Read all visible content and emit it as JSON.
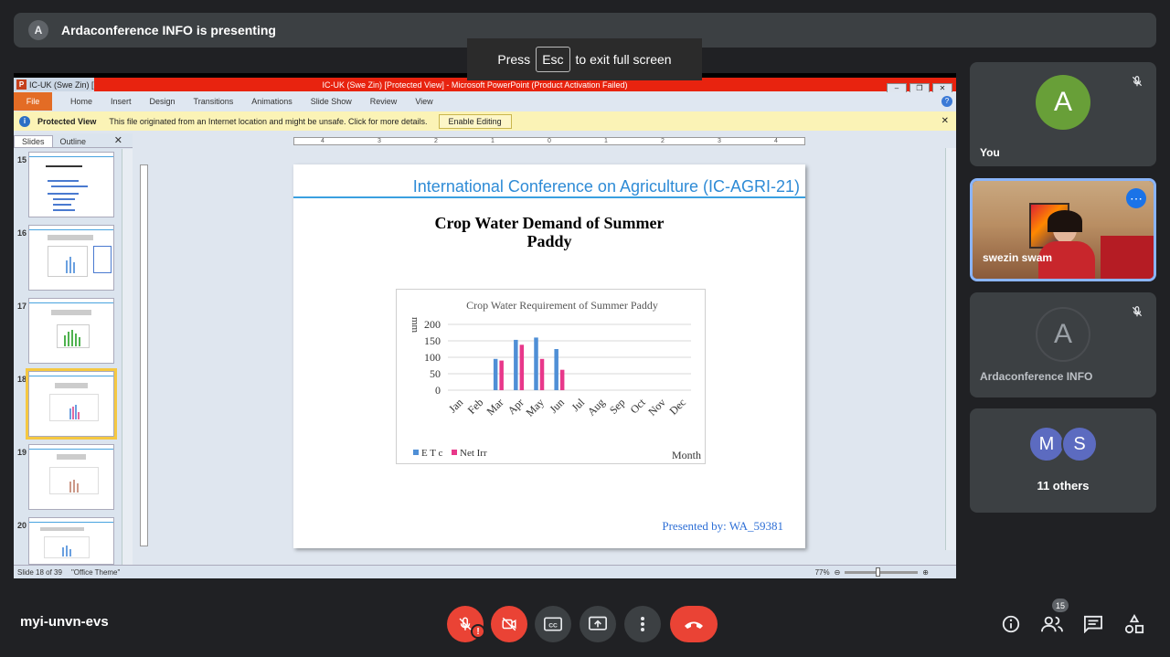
{
  "topbar": {
    "avatar_letter": "A",
    "presenting_text": "Ardaconference INFO is presenting"
  },
  "fullscreen_hint": {
    "press": "Press",
    "key": "Esc",
    "rest": "to exit full screen"
  },
  "ppt": {
    "window_title_left": "IC-UK (Swe Zin) [",
    "window_title": "IC-UK (Swe Zin) [Protected View] - Microsoft PowerPoint (Product Activation Failed)",
    "ribbon_tabs": [
      "File",
      "Home",
      "Insert",
      "Design",
      "Transitions",
      "Animations",
      "Slide Show",
      "Review",
      "View"
    ],
    "protected_label": "Protected View",
    "protected_message": "This file originated from an Internet location and might be unsafe. Click for more details.",
    "enable_editing": "Enable Editing",
    "panel_tabs": [
      "Slides",
      "Outline"
    ],
    "thumb_numbers": [
      "15",
      "16",
      "17",
      "18",
      "19",
      "20"
    ],
    "selected_slide": "18",
    "status_slide": "Slide 18 of 39",
    "status_theme": "\"Office Theme\"",
    "zoom": "77%",
    "ruler_marks": [
      "4",
      "3",
      "2",
      "1",
      "0",
      "1",
      "2",
      "3",
      "4"
    ]
  },
  "slide": {
    "conference": "International Conference on Agriculture (IC-AGRI-21)",
    "heading_line1": "Crop Water Demand of Summer",
    "heading_line2": "Paddy",
    "presented_by": "Presented by:  WA_59381"
  },
  "chart_data": {
    "type": "bar",
    "title": "Crop Water Requirement of Summer Paddy",
    "ylabel": "mm",
    "xlabel": "Month",
    "ylim": [
      0,
      200
    ],
    "yticks": [
      0,
      50,
      100,
      150,
      200
    ],
    "categories": [
      "Jan",
      "Feb",
      "Mar",
      "Apr",
      "May",
      "Jun",
      "Jul",
      "Aug",
      "Sep",
      "Oct",
      "Nov",
      "Dec"
    ],
    "series": [
      {
        "name": "E T c",
        "color": "#4f8fd6",
        "values": [
          0,
          0,
          95,
          153,
          160,
          125,
          0,
          0,
          0,
          0,
          0,
          0
        ]
      },
      {
        "name": "Net Irr",
        "color": "#e8388a",
        "values": [
          0,
          0,
          90,
          138,
          95,
          62,
          0,
          0,
          0,
          0,
          0,
          0
        ]
      }
    ],
    "legend": "bottom-left",
    "grid": true
  },
  "participants": {
    "you": {
      "letter": "A",
      "name": "You",
      "color": "#689f38"
    },
    "presenter_video": {
      "name": "swezin swam"
    },
    "ardaconference": {
      "letter": "A",
      "name": "Ardaconference INFO"
    },
    "others": {
      "letters": [
        "M",
        "S"
      ],
      "colors": [
        "#5c6bc0",
        "#5c6bc0"
      ],
      "label": "11 others"
    }
  },
  "bottom": {
    "meeting_code": "myi-unvn-evs",
    "participants_count": "15",
    "mic_warning": "!"
  }
}
